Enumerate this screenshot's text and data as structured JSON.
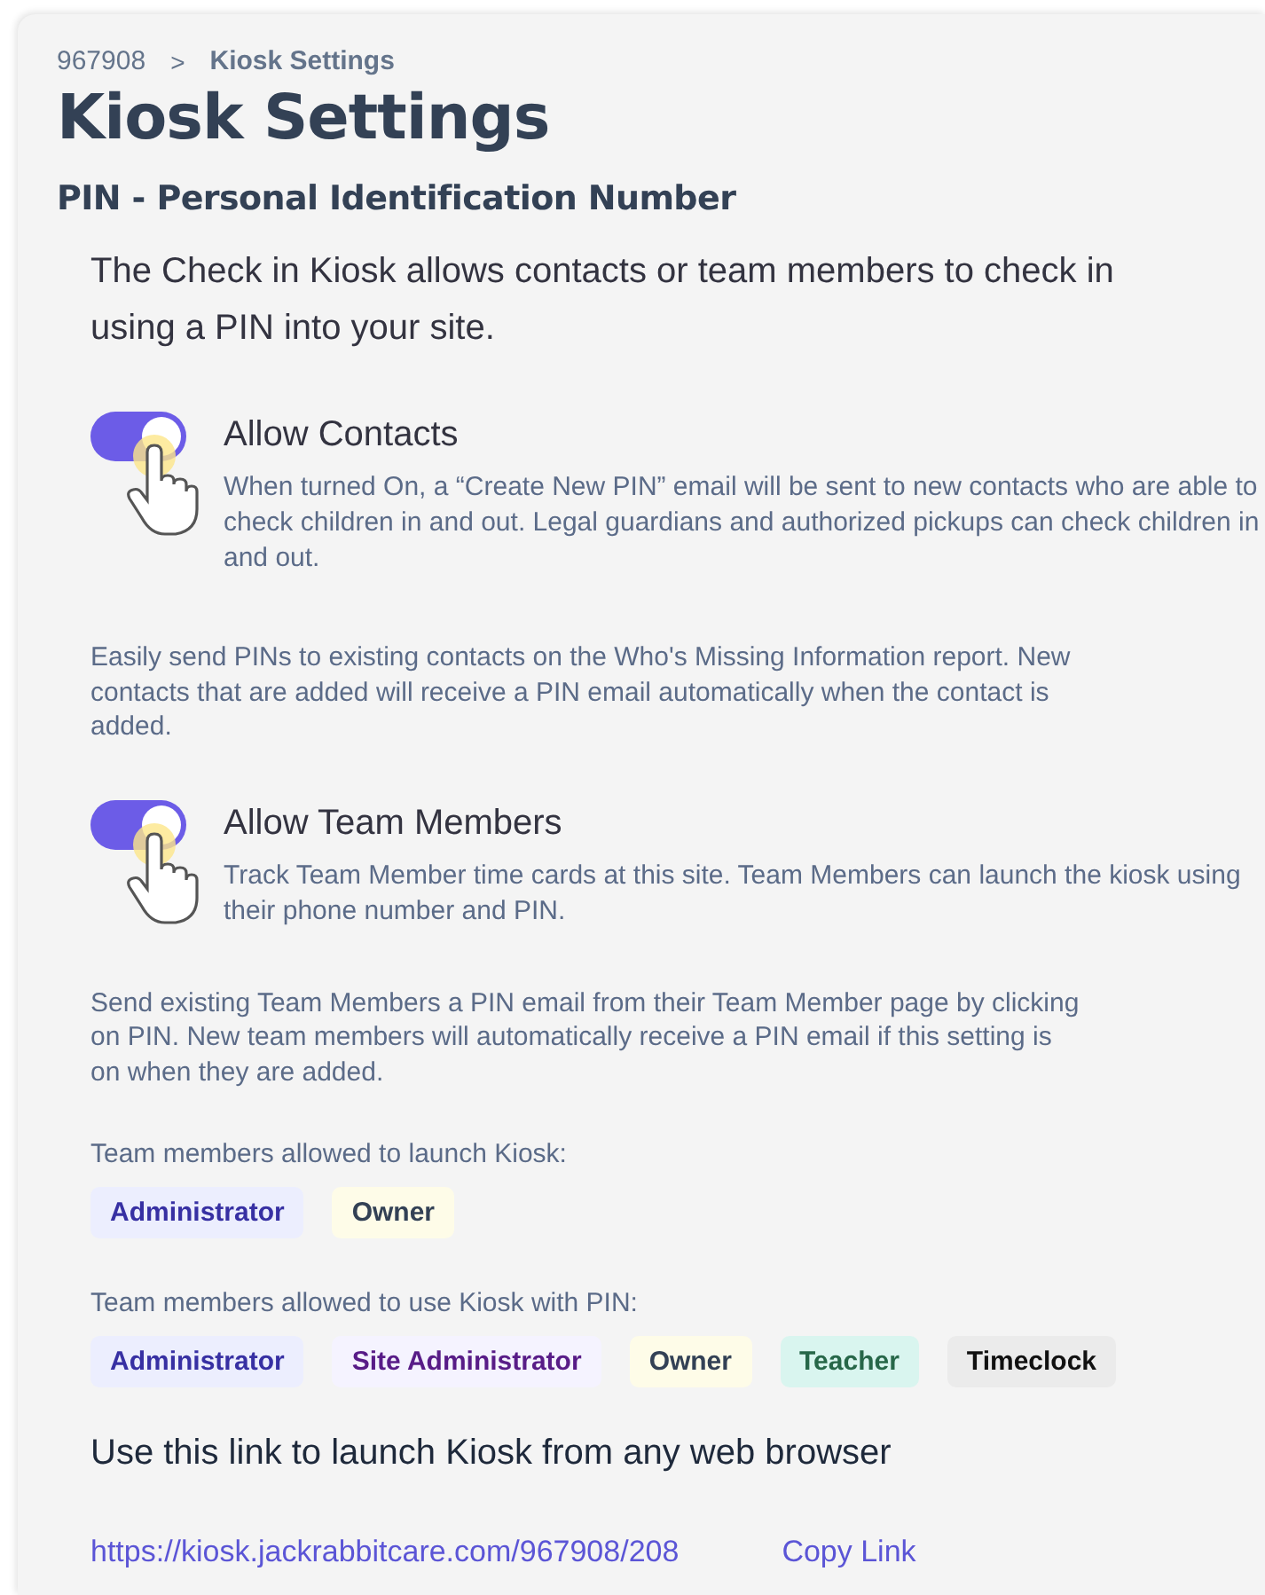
{
  "breadcrumb": {
    "parent": "967908",
    "separator": ">",
    "current": "Kiosk Settings"
  },
  "title": "Kiosk Settings",
  "section_title": "PIN - Personal Identification Number",
  "intro": "The Check in Kiosk allows contacts or team members to check in using a PIN into your site.",
  "toggles": [
    {
      "label": "Allow Contacts",
      "on": true,
      "description": "When turned On, a “Create New PIN” email will be sent to new contacts who are able to check children in and out. Legal guardians and authorized pickups can check children in and out.",
      "note": "Easily send PINs to existing contacts on the Who's Missing Information report. New contacts that are added will receive a PIN email automatically when the contact is added."
    },
    {
      "label": "Allow Team Members",
      "on": true,
      "description": "Track Team Member time cards at this site. Team Members can launch the kiosk using their phone number and PIN.",
      "note": "Send existing Team Members a PIN email from their Team Member page by clicking on PIN. New team members will automatically receive a PIN email if this setting is on when they are added."
    }
  ],
  "role_groups": [
    {
      "label": "Team members allowed to launch Kiosk:",
      "roles": [
        {
          "name": "Administrator",
          "kind": "indigo",
          "color": "#3730a3"
        },
        {
          "name": "Owner",
          "kind": "yellow",
          "color": "#334155"
        }
      ]
    },
    {
      "label": "Team members allowed to use Kiosk with PIN:",
      "roles": [
        {
          "name": "Administrator",
          "kind": "indigo",
          "color": "#3730a3"
        },
        {
          "name": "Site Administrator",
          "kind": "violet",
          "color": "#581c87"
        },
        {
          "name": "Owner",
          "kind": "yellow",
          "color": "#334155"
        },
        {
          "name": "Teacher",
          "kind": "teal",
          "color": "#276749"
        },
        {
          "name": "Timeclock",
          "kind": "gray",
          "color": "#111111"
        }
      ]
    }
  ],
  "link_section": {
    "heading": "Use this link to launch Kiosk from any web browser",
    "url": "https://kiosk.jackrabbitcare.com/967908/208",
    "copy_label": "Copy Link"
  }
}
